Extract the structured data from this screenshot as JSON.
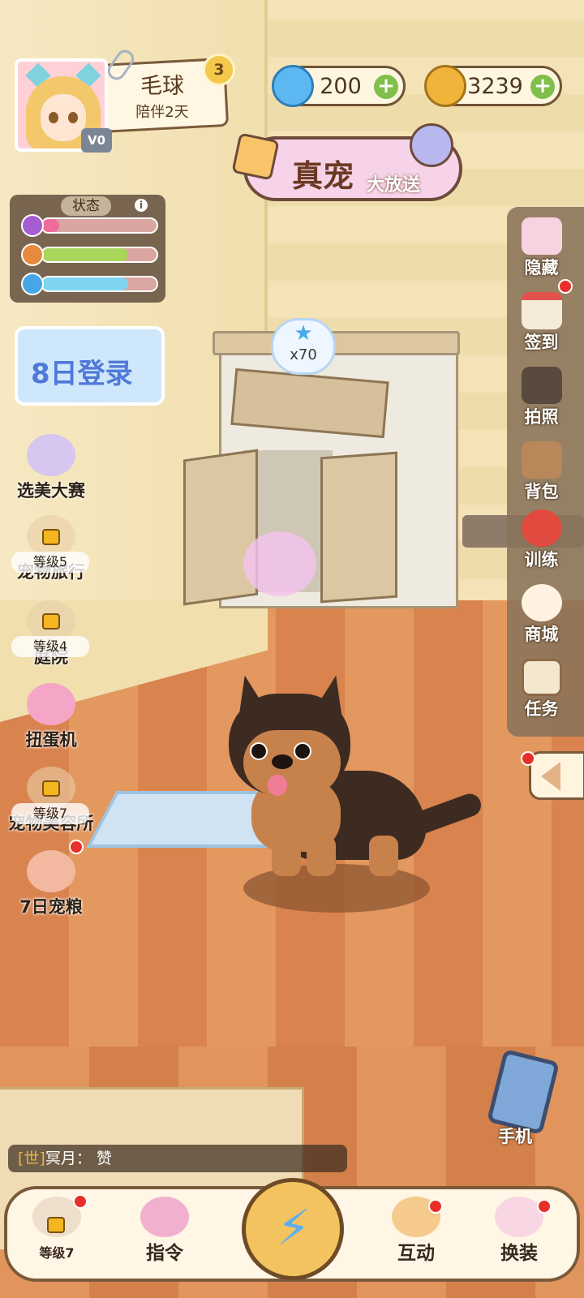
{
  "profile": {
    "pet_name": "毛球",
    "days_label": "陪伴2天",
    "level": "3",
    "vip": "V0"
  },
  "currency": {
    "gems": "200",
    "coins": "3239"
  },
  "banner": {
    "title": "真宠",
    "subtitle": "大放送"
  },
  "status": {
    "title": "状态",
    "info": "i",
    "bars": [
      {
        "name": "mood",
        "value": 0.15,
        "color": "#f06a9a"
      },
      {
        "name": "food",
        "value": 0.75,
        "color": "#a7d65a"
      },
      {
        "name": "water",
        "value": 0.75,
        "color": "#7fd4ef"
      }
    ]
  },
  "left_menu": {
    "login_event": "8日登录",
    "items": [
      {
        "label": "选美大赛"
      },
      {
        "label": "宠物旅行",
        "lock": "等级5"
      },
      {
        "label": "庭院",
        "lock": "等级4"
      },
      {
        "label": "扭蛋机"
      },
      {
        "label": "宠物美容所",
        "lock": "等级7"
      },
      {
        "label": "7日宠粮"
      }
    ]
  },
  "scene": {
    "reward_count": "x70"
  },
  "right_menu": {
    "items": [
      {
        "label": "隐藏",
        "icon": "paw-hide-icon"
      },
      {
        "label": "签到",
        "icon": "calendar-icon"
      },
      {
        "label": "拍照",
        "icon": "camera-icon"
      },
      {
        "label": "背包",
        "icon": "backpack-icon"
      },
      {
        "label": "训练",
        "icon": "bowl-icon"
      },
      {
        "label": "商城",
        "icon": "shop-cat-icon"
      },
      {
        "label": "任务",
        "icon": "clipboard-icon"
      }
    ]
  },
  "chat": {
    "channel": "[世]",
    "user": "冥月：",
    "message": "赞"
  },
  "phone": {
    "label": "手机"
  },
  "bottom_bar": {
    "items": [
      {
        "label": "",
        "lock": "等级7"
      },
      {
        "label": "指令"
      },
      {
        "label": "互动"
      },
      {
        "label": "换装"
      }
    ]
  },
  "colors": {
    "accent_brown": "#7a5a3a",
    "notification_red": "#e8302a",
    "plus_green": "#7fbf4a"
  }
}
